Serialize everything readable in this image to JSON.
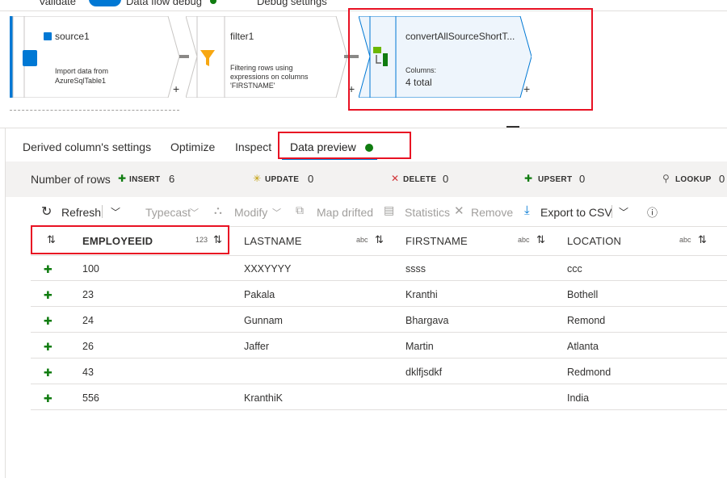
{
  "toolbar_top": {
    "validate": "Validate",
    "dataflow_debug": "Data flow debug",
    "debug_settings": "Debug settings"
  },
  "nodes": [
    {
      "title": "source1",
      "desc_line1": "Import data from",
      "desc_line2": "AzureSqlTable1"
    },
    {
      "title": "filter1",
      "desc_line1": "Filtering rows using",
      "desc_line2": "expressions on columns",
      "desc_line3": "'FIRSTNAME'"
    },
    {
      "title": "convertAllSourceShortT...",
      "cols_label": "Columns:",
      "cols_value": "4 total"
    }
  ],
  "tabs": [
    {
      "label": "Derived column's settings"
    },
    {
      "label": "Optimize"
    },
    {
      "label": "Inspect"
    },
    {
      "label": "Data preview"
    }
  ],
  "stats": {
    "rows_label": "Number of rows",
    "insert_label": "INSERT",
    "insert_value": "6",
    "update_label": "UPDATE",
    "update_value": "0",
    "delete_label": "DELETE",
    "delete_value": "0",
    "upsert_label": "UPSERT",
    "upsert_value": "0",
    "lookup_label": "LOOKUP",
    "lookup_value": "0"
  },
  "toolbar": {
    "refresh": "Refresh",
    "typecast": "Typecast",
    "modify": "Modify",
    "map_drifted": "Map drifted",
    "statistics": "Statistics",
    "remove": "Remove",
    "export": "Export to CSV"
  },
  "columns": [
    {
      "name": "EMPLOYEEID",
      "type": "123"
    },
    {
      "name": "LASTNAME",
      "type": "abc"
    },
    {
      "name": "FIRSTNAME",
      "type": "abc"
    },
    {
      "name": "LOCATION",
      "type": "abc"
    }
  ],
  "rows": [
    [
      "100",
      "XXXYYYY",
      "ssss",
      "ccc"
    ],
    [
      "23",
      "Pakala",
      "Kranthi",
      "Bothell"
    ],
    [
      "24",
      "Gunnam",
      "Bhargava",
      "Remond"
    ],
    [
      "26",
      "Jaffer",
      "Martin",
      "Atlanta"
    ],
    [
      "43",
      "",
      "dklfjsdkf",
      "Redmond"
    ],
    [
      "556",
      "KranthiK",
      "",
      "India"
    ]
  ],
  "colors": {
    "accent": "#0078d4",
    "success": "#107c10",
    "highlight": "#e81123"
  }
}
